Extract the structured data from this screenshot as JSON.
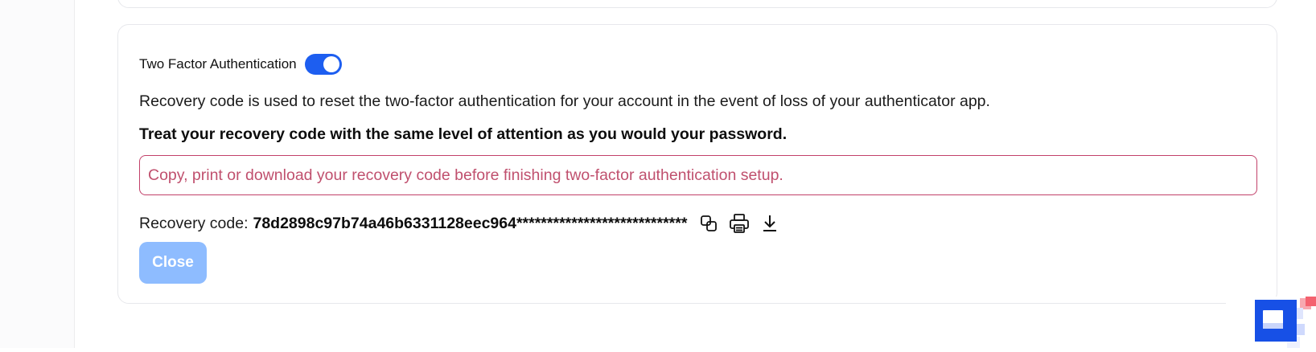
{
  "two_factor": {
    "label": "Two Factor Authentication",
    "enabled": true
  },
  "description": "Recovery code is used to reset the two-factor authentication for your account in the event of loss of your authenticator app.",
  "warning": "Treat your recovery code with the same level of attention as you would your password.",
  "alert": "Copy, print or download your recovery code before finishing two-factor authentication setup.",
  "recovery": {
    "label": "Recovery code:",
    "code": "78d2898c97b74a46b6331128eec964****************************",
    "icons": [
      "copy-icon",
      "print-icon",
      "download-icon"
    ]
  },
  "close_label": "Close",
  "colors": {
    "accent": "#1d5ef0",
    "alert_border": "#c2416a",
    "alert_text": "#c0506e",
    "close_button": "#8ebcff"
  }
}
